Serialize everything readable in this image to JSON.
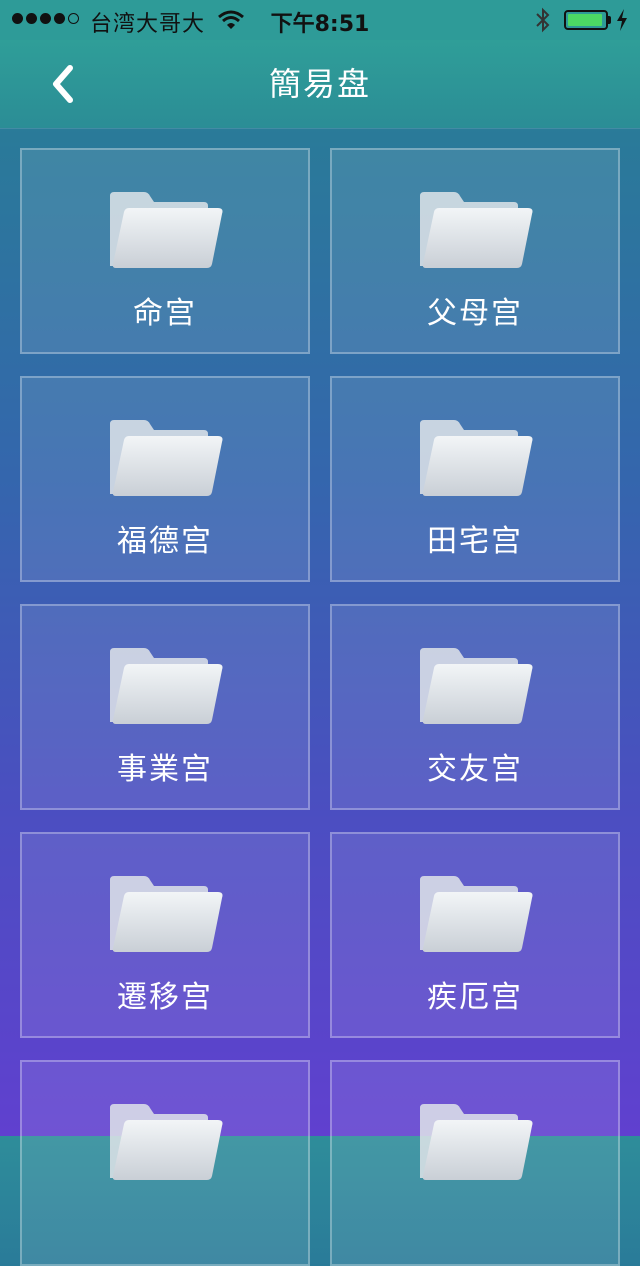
{
  "status_bar": {
    "carrier": "台湾大哥大",
    "time": "下午8:51",
    "signal_icon": "signal-dots-icon",
    "wifi_icon": "wifi-icon",
    "bluetooth_icon": "bluetooth-icon",
    "battery_icon": "battery-icon",
    "battery_level": 0.95,
    "battery_color": "#4cd964"
  },
  "nav": {
    "title": "簡易盘",
    "back_icon": "chevron-left-icon"
  },
  "colors": {
    "nav_bg": "#2f9e98",
    "gradient_top": "#2e8d9a",
    "gradient_bottom": "#6040cf"
  },
  "tiles": [
    {
      "label": "命宫",
      "icon": "folder-icon"
    },
    {
      "label": "父母宫",
      "icon": "folder-icon"
    },
    {
      "label": "福德宫",
      "icon": "folder-icon"
    },
    {
      "label": "田宅宫",
      "icon": "folder-icon"
    },
    {
      "label": "事業宫",
      "icon": "folder-icon"
    },
    {
      "label": "交友宫",
      "icon": "folder-icon"
    },
    {
      "label": "遷移宫",
      "icon": "folder-icon"
    },
    {
      "label": "疾厄宫",
      "icon": "folder-icon"
    },
    {
      "label": "",
      "icon": "folder-icon"
    },
    {
      "label": "",
      "icon": "folder-icon"
    }
  ]
}
